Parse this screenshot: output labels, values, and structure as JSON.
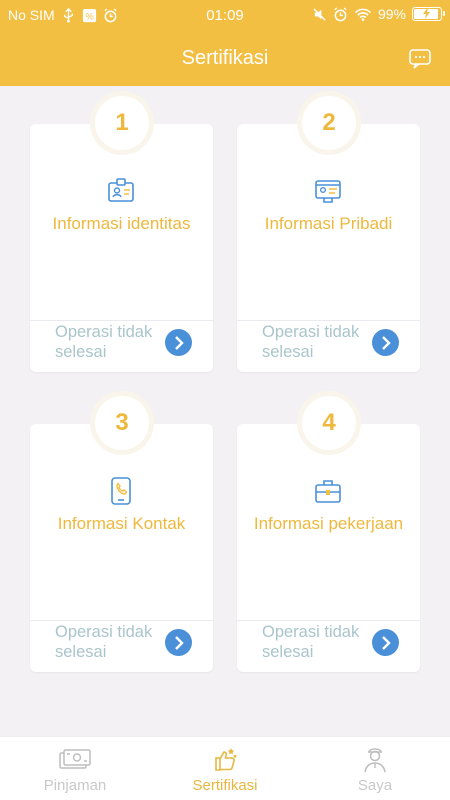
{
  "status_bar": {
    "carrier": "No SIM",
    "time": "01:09",
    "battery": "99%",
    "battery_level": 0.99,
    "icons": [
      "usb-icon",
      "percent-icon",
      "alarm-icon",
      "mute-icon",
      "alarm-icon",
      "wifi-icon",
      "battery-charging-icon"
    ]
  },
  "header": {
    "title": "Sertifikasi",
    "message_icon": "chat-bubble-icon",
    "color": "#f2bf42"
  },
  "steps": [
    {
      "number": "1",
      "title": "Informasi identitas",
      "status": "Operasi tidak selesai",
      "icon": "id-card-icon"
    },
    {
      "number": "2",
      "title": "Informasi Pribadi",
      "status": "Operasi tidak selesai",
      "icon": "personal-info-icon"
    },
    {
      "number": "3",
      "title": "Informasi Kontak",
      "status": "Operasi tidak selesai",
      "icon": "phone-icon"
    },
    {
      "number": "4",
      "title": "Informasi pekerjaan",
      "status": "Operasi tidak selesai",
      "icon": "briefcase-icon"
    }
  ],
  "tabbar": {
    "items": [
      {
        "label": "Pinjaman",
        "icon": "money-icon",
        "active": false
      },
      {
        "label": "Sertifikasi",
        "icon": "thumbs-up-icon",
        "active": true
      },
      {
        "label": "Saya",
        "icon": "user-icon",
        "active": false
      }
    ]
  },
  "colors": {
    "accent": "#f2bf42",
    "accent_text": "#eeb83c",
    "action_blue": "#4a90d9",
    "status_text": "#a9c5cc",
    "background": "#f4f1f4"
  }
}
